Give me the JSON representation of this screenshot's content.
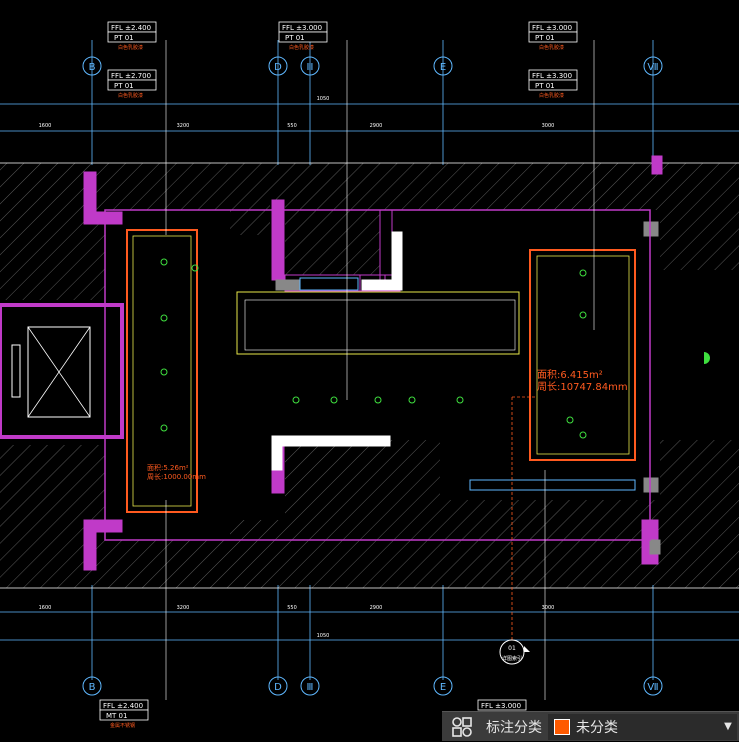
{
  "drawing": {
    "grid_labels_top": [
      "B",
      "D",
      "Ⅲ",
      "E",
      "Ⅶ"
    ],
    "grid_labels_bottom": [
      "B",
      "D",
      "Ⅲ",
      "E",
      "Ⅶ"
    ],
    "ffl_tags": [
      {
        "ffl": "FFL ±2.400",
        "code": "PT 01",
        "note": "白色乳胶漆"
      },
      {
        "ffl": "FFL ±2.700",
        "code": "PT 01",
        "note": "白色乳胶漆"
      },
      {
        "ffl": "FFL ±3.000",
        "code": "PT 01",
        "note": "白色乳胶漆"
      },
      {
        "ffl": "FFL ±3.000",
        "code": "PT 01",
        "note": "白色乳胶漆"
      },
      {
        "ffl": "FFL ±3.300",
        "code": "PT 01",
        "note": "白色乳胶漆"
      },
      {
        "ffl": "FFL ±2.400",
        "code": "MT 01",
        "note": "金属不锈钢"
      },
      {
        "ffl": "FFL ±3.000",
        "code": "",
        "note": ""
      }
    ],
    "dims_top_row1": [
      "1050"
    ],
    "dims_top_row2": [
      "1600",
      "3200",
      "550",
      "2900",
      "3000"
    ],
    "dims_bottom_row1": [
      "1600",
      "3200",
      "550",
      "2900",
      "3000"
    ],
    "dims_bottom_row2": [
      "1050"
    ],
    "area_left": {
      "area": "面积:5.26m²",
      "perimeter": "周长:1000.00mm"
    },
    "area_right": {
      "area": "面积:6.415m²",
      "perimeter": "周长:10747.84mm"
    },
    "section_mark": {
      "num": "01",
      "ref": "详图索引"
    },
    "colors": {
      "magenta": "#c03ac8",
      "cyan": "#5fb8ff",
      "orange": "#ff5a1f",
      "green": "#3fe03f",
      "yellow": "#e8e84a",
      "white": "#ffffff",
      "hatch": "#6a6a6a"
    }
  },
  "statusbar": {
    "icon": "category-grid-icon",
    "label": "标注分类",
    "selected": "未分类",
    "swatch_color": "#ff5a00"
  }
}
